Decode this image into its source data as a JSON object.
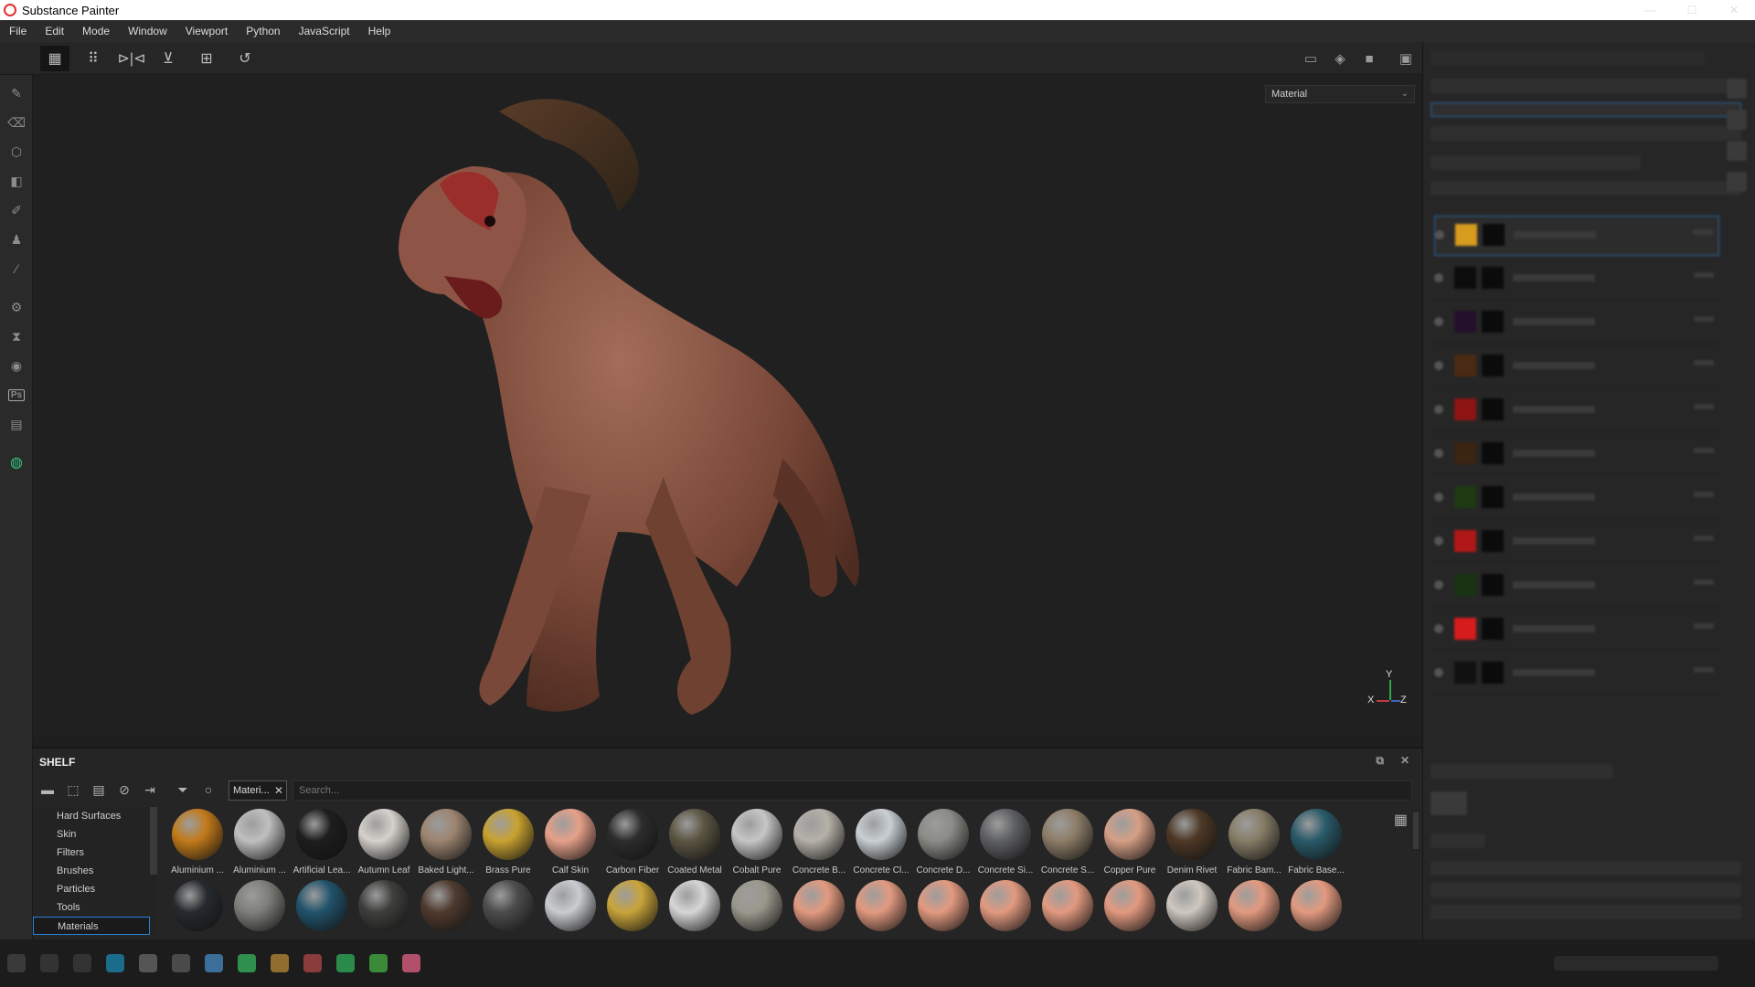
{
  "app": {
    "title": "Substance Painter",
    "accent_color": "#2b7fd9"
  },
  "menu": [
    "File",
    "Edit",
    "Mode",
    "Window",
    "Viewport",
    "Python",
    "JavaScript",
    "Help"
  ],
  "toolbar": {
    "icons": [
      "grid-select-icon",
      "grid-dots-icon",
      "mirror-x-icon",
      "mirror-y-icon",
      "add-frame-icon",
      "history-icon",
      "screenshot-icon",
      "cube-icon",
      "camera-icon",
      "settings-icon"
    ]
  },
  "left_tools": [
    "paint-brush-icon",
    "eraser-icon",
    "projection-icon",
    "polygon-fill-icon",
    "smudge-icon",
    "clone-stamp-icon",
    "color-picker-icon",
    "bake-settings-icon",
    "hourglass-icon",
    "material-icon",
    "photoshop-icon",
    "export-icon",
    "plugin-icon"
  ],
  "viewport": {
    "mode_dropdown": "Material",
    "axis": {
      "y": "Y",
      "x": "X",
      "z": "Z"
    }
  },
  "shelf": {
    "title": "SHELF",
    "filter_tag": "Materi...",
    "search_placeholder": "Search...",
    "categories": [
      {
        "label": "Hard Surfaces",
        "selected": false
      },
      {
        "label": "Skin",
        "selected": false
      },
      {
        "label": "Filters",
        "selected": false
      },
      {
        "label": "Brushes",
        "selected": false
      },
      {
        "label": "Particles",
        "selected": false
      },
      {
        "label": "Tools",
        "selected": false
      },
      {
        "label": "Materials",
        "selected": true
      }
    ],
    "materials_row1": [
      {
        "label": "Aluminium ...",
        "color": "#c27a1a"
      },
      {
        "label": "Aluminium ...",
        "color": "#bfbfbf"
      },
      {
        "label": "Artificial Lea...",
        "color": "#1d1d1d"
      },
      {
        "label": "Autumn Leaf",
        "color": "#d5d1cc"
      },
      {
        "label": "Baked Light...",
        "color": "#9c8470"
      },
      {
        "label": "Brass Pure",
        "color": "#c9a230"
      },
      {
        "label": "Calf Skin",
        "color": "#e5a089"
      },
      {
        "label": "Carbon Fiber",
        "color": "#2c2c2c"
      },
      {
        "label": "Coated Metal",
        "color": "#5b5542"
      },
      {
        "label": "Cobalt Pure",
        "color": "#c6c6c6"
      },
      {
        "label": "Concrete B...",
        "color": "#b5b1a8"
      },
      {
        "label": "Concrete Cl...",
        "color": "#c9cfd3"
      },
      {
        "label": "Concrete D...",
        "color": "#8b8b87"
      },
      {
        "label": "Concrete Si...",
        "color": "#5f6063"
      },
      {
        "label": "Concrete S...",
        "color": "#8d7d68"
      },
      {
        "label": "Copper Pure",
        "color": "#d59f86"
      },
      {
        "label": "Denim Rivet",
        "color": "#4d3826"
      },
      {
        "label": "Fabric Bam...",
        "color": "#867d66"
      },
      {
        "label": "Fabric Base...",
        "color": "#2a5a6a"
      }
    ],
    "materials_row2": [
      {
        "color": "#262a2e"
      },
      {
        "color": "#7e7e7a"
      },
      {
        "color": "#21536b"
      },
      {
        "color": "#3e3e3c"
      },
      {
        "color": "#4f3a2e"
      },
      {
        "color": "#4c4c4e"
      },
      {
        "color": "#c9ccd0"
      },
      {
        "color": "#c9a43a"
      },
      {
        "color": "#d6d6d6"
      },
      {
        "color": "#9a988c"
      },
      {
        "color": "#e29a80"
      },
      {
        "color": "#e29a80"
      },
      {
        "color": "#e29a80"
      },
      {
        "color": "#e29a80"
      },
      {
        "color": "#e29a80"
      },
      {
        "color": "#e29a80"
      },
      {
        "color": "#cfc8c0"
      },
      {
        "color": "#e29a80"
      },
      {
        "color": "#e29a80"
      }
    ]
  },
  "layers": [
    {
      "thumb": "#d79b1e",
      "selected": true
    },
    {
      "thumb": "#0c0c0c",
      "selected": false
    },
    {
      "thumb": "#24102a",
      "selected": false
    },
    {
      "thumb": "#4a2a12",
      "selected": false
    },
    {
      "thumb": "#8e1414",
      "selected": false
    },
    {
      "thumb": "#3a2412",
      "selected": false
    },
    {
      "thumb": "#1d3a12",
      "selected": false
    },
    {
      "thumb": "#b01818",
      "selected": false
    },
    {
      "thumb": "#193412",
      "selected": false
    },
    {
      "thumb": "#d61c1c",
      "selected": false
    },
    {
      "thumb": "#111111",
      "selected": false
    }
  ]
}
